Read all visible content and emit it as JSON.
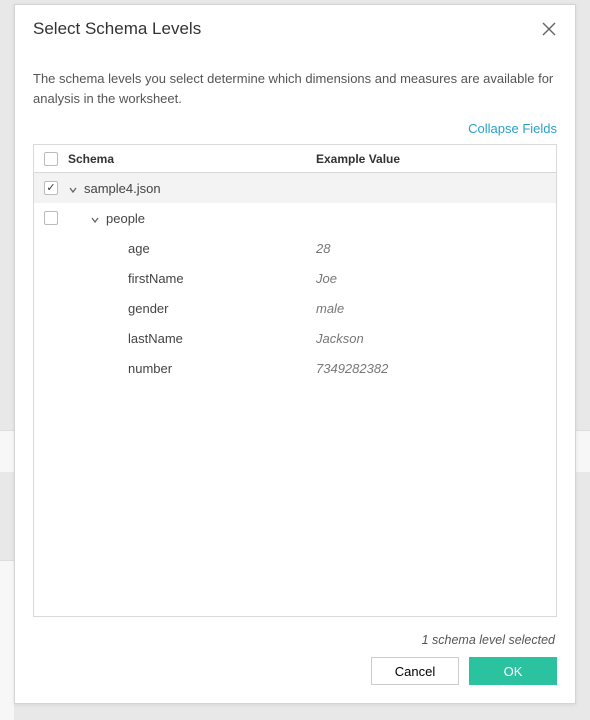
{
  "dialog": {
    "title": "Select Schema Levels",
    "description": "The schema levels you select determine which dimensions and measures are available for analysis in the worksheet.",
    "collapse_label": "Collapse Fields"
  },
  "table": {
    "headers": {
      "schema": "Schema",
      "example": "Example Value"
    },
    "rows": [
      {
        "checked": true,
        "expandable": true,
        "indent": 0,
        "label": "sample4.json",
        "example": "",
        "selected": true
      },
      {
        "checked": false,
        "expandable": true,
        "indent": 1,
        "label": "people",
        "example": "",
        "selected": false
      },
      {
        "checked": null,
        "expandable": false,
        "indent": 2,
        "label": "age",
        "example": "28",
        "selected": false
      },
      {
        "checked": null,
        "expandable": false,
        "indent": 2,
        "label": "firstName",
        "example": "Joe",
        "selected": false
      },
      {
        "checked": null,
        "expandable": false,
        "indent": 2,
        "label": "gender",
        "example": "male",
        "selected": false
      },
      {
        "checked": null,
        "expandable": false,
        "indent": 2,
        "label": "lastName",
        "example": "Jackson",
        "selected": false
      },
      {
        "checked": null,
        "expandable": false,
        "indent": 2,
        "label": "number",
        "example": "7349282382",
        "selected": false
      }
    ]
  },
  "status": "1 schema level selected",
  "buttons": {
    "cancel": "Cancel",
    "ok": "OK"
  }
}
